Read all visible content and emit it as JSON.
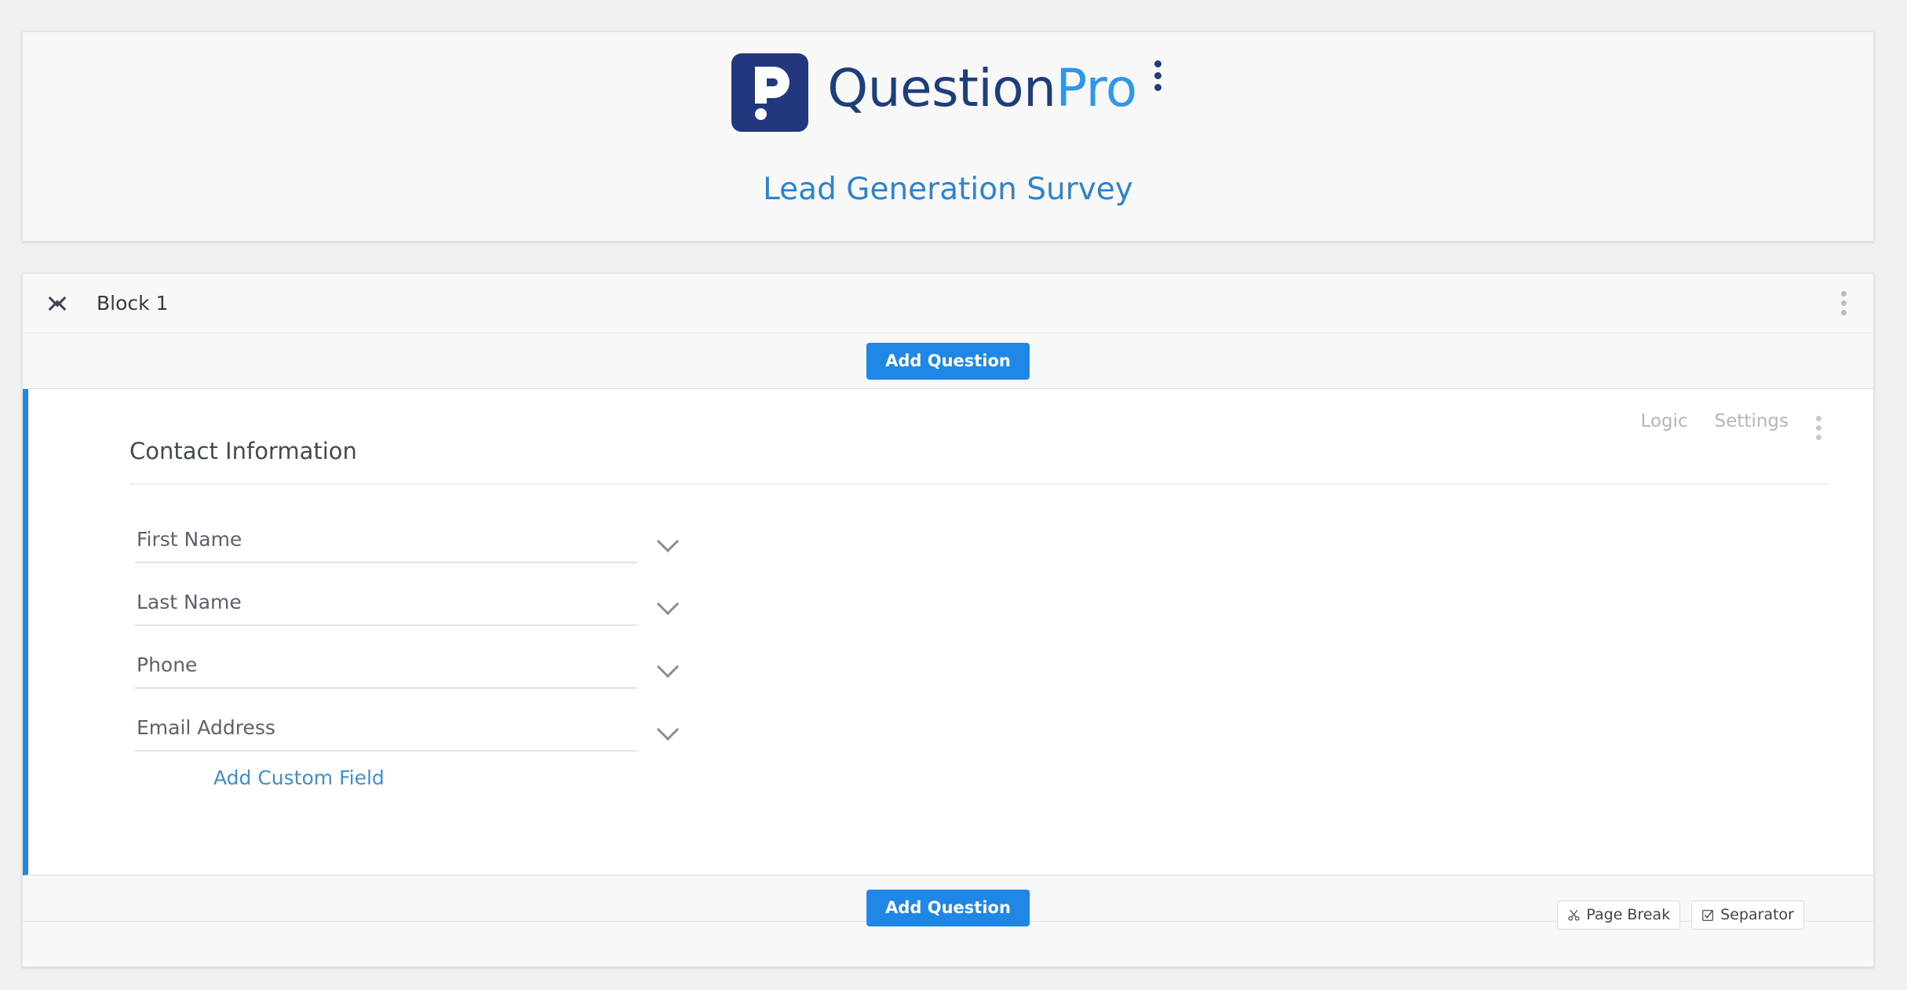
{
  "page": {
    "background_color": "#f0f0f0"
  },
  "header": {
    "logo": {
      "mark_icon": "questionpro-logo-icon",
      "word_part1": "Question",
      "word_part2": "Pro",
      "mark_color": "#22377e",
      "word1_color": "#1e3d7b",
      "word2_color": "#2f96e8"
    },
    "kebab_icon": "more-vertical-icon",
    "survey_title": "Lead Generation Survey",
    "survey_title_color": "#2f82cc"
  },
  "block": {
    "collapse_icon": "collapse-expand-icon",
    "title": "Block 1",
    "kebab_icon": "more-vertical-icon",
    "add_question_label": "Add Question"
  },
  "question": {
    "actions": [
      {
        "label": "Logic",
        "name": "logic"
      },
      {
        "label": "Settings",
        "name": "settings"
      }
    ],
    "kebab_icon": "more-vertical-icon",
    "heading": "Contact Information",
    "fields": [
      {
        "label": "First Name",
        "chevron_icon": "chevron-down-icon"
      },
      {
        "label": "Last Name",
        "chevron_icon": "chevron-down-icon"
      },
      {
        "label": "Phone",
        "chevron_icon": "chevron-down-icon"
      },
      {
        "label": "Email Address",
        "chevron_icon": "chevron-down-icon"
      }
    ],
    "add_custom_field_label": "Add Custom Field",
    "accent_color": "#1f87e5"
  },
  "footer": {
    "add_question_label": "Add Question",
    "page_break_label": "Page Break",
    "page_break_icon": "page-break-icon",
    "separator_label": "Separator",
    "separator_icon": "checked-box-icon"
  }
}
